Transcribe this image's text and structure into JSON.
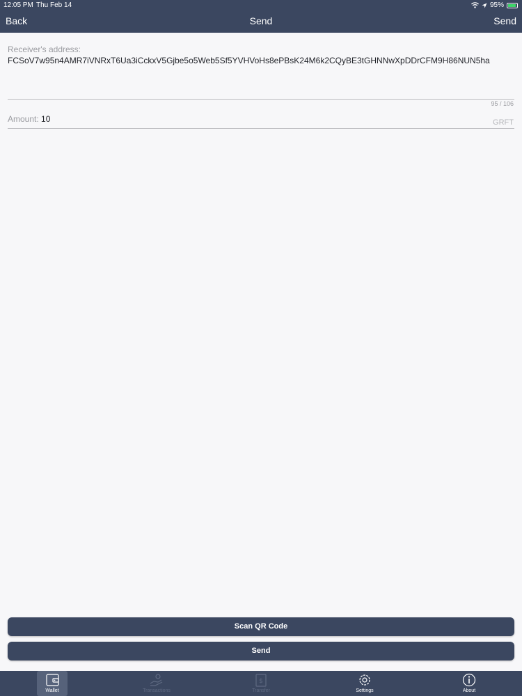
{
  "status_bar": {
    "time": "12:05 PM",
    "date": "Thu Feb 14",
    "battery_percent": "95%",
    "battery_level": 0.95
  },
  "nav": {
    "back_label": "Back",
    "title": "Send",
    "action_label": "Send"
  },
  "form": {
    "receiver_label": "Receiver's address:",
    "receiver_address": "FCSoV7w95n4AMR7iVNRxT6Ua3iCckxV5Gjbe5o5Web5Sf5YVHVoHs8ePBsK24M6k2CQyBE3tGHNNwXpDDrCFM9H86NUN5ha",
    "char_counter": "95 / 106",
    "amount_label": "Amount:",
    "amount_value": "10",
    "amount_unit": "GRFT"
  },
  "buttons": {
    "scan_qr_label": "Scan QR Code",
    "send_label": "Send"
  },
  "tabs": [
    {
      "label": "Wallet",
      "icon": "wallet-icon",
      "active": true
    },
    {
      "label": "Transactions",
      "icon": "hand-coin-icon",
      "active": false
    },
    {
      "label": "Transfer",
      "icon": "transfer-icon",
      "active": false
    },
    {
      "label": "Settings",
      "icon": "gear-icon",
      "active": false
    },
    {
      "label": "About",
      "icon": "info-icon",
      "active": false
    }
  ],
  "colors": {
    "bar": "#3b4760",
    "background": "#f7f7f9",
    "battery": "#3fd46a"
  }
}
